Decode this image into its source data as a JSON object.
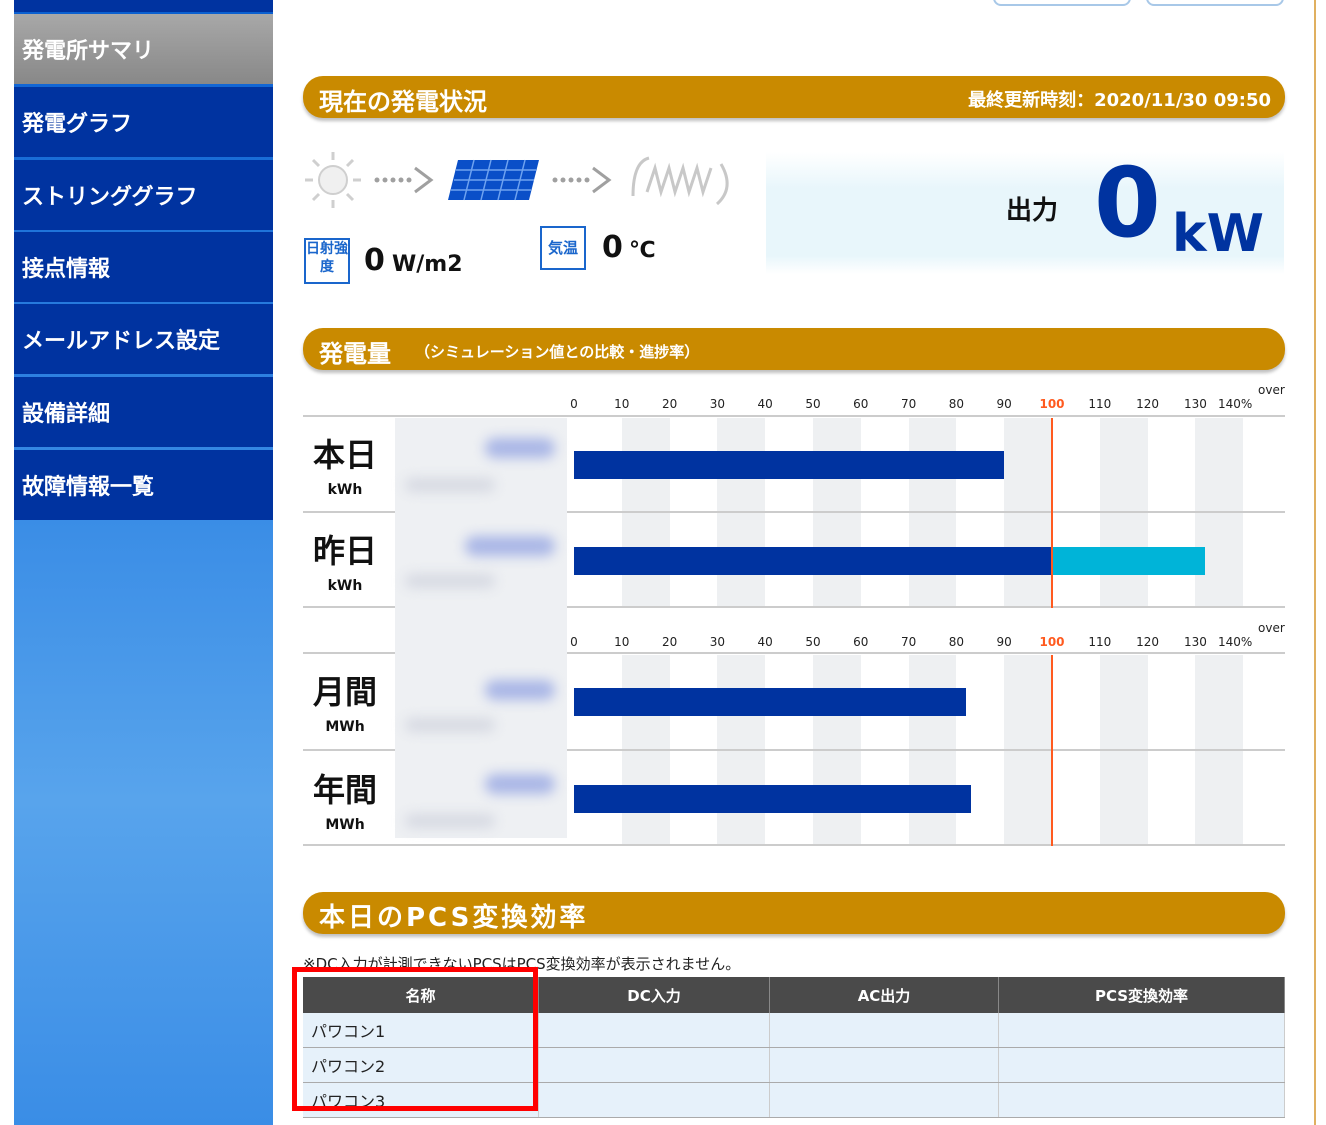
{
  "sidebar": {
    "items": [
      {
        "label": "発電所サマリ",
        "active": true
      },
      {
        "label": "発電グラフ",
        "active": false
      },
      {
        "label": "ストリンググラフ",
        "active": false
      },
      {
        "label": "接点情報",
        "active": false
      },
      {
        "label": "メールアドレス設定",
        "active": false
      },
      {
        "label": "設備詳細",
        "active": false
      },
      {
        "label": "故障情報一覧",
        "active": false
      }
    ]
  },
  "status": {
    "title": "現在の発電状況",
    "updated": "最終更新時刻：2020/11/30 09:50",
    "irradiance_badge": "日射強度",
    "irradiance_value": "0",
    "irradiance_unit": "W/m2",
    "temp_badge": "気温",
    "temp_value": "0",
    "temp_unit": "℃",
    "output_label": "出力",
    "output_value": "0",
    "output_unit": "kW",
    "icons": [
      "sun-icon",
      "arrow-right-icon",
      "solar-panel-icon",
      "arrow-right-icon",
      "power-wave-icon"
    ]
  },
  "generation": {
    "title": "発電量",
    "subtitle": "（シミュレーション値との比較・進捗率）",
    "scale_over": "over",
    "rows_group1": [
      {
        "label": "本日",
        "unit": "kWh"
      },
      {
        "label": "昨日",
        "unit": "kWh"
      }
    ],
    "rows_group2": [
      {
        "label": "月間",
        "unit": "MWh"
      },
      {
        "label": "年間",
        "unit": "MWh"
      }
    ]
  },
  "chart_data": {
    "type": "bar",
    "orientation": "horizontal",
    "x_ticks": [
      "0",
      "10",
      "20",
      "30",
      "40",
      "50",
      "60",
      "70",
      "80",
      "90",
      "100",
      "110",
      "120",
      "130",
      "140%"
    ],
    "xlim": [
      0,
      150
    ],
    "reference_line": 100,
    "colors": {
      "base": "#0033a0",
      "over": "#00b4d8",
      "reference": "#ff5a1f"
    },
    "groups": [
      {
        "categories": [
          "本日",
          "昨日"
        ],
        "values": [
          90,
          132
        ]
      },
      {
        "categories": [
          "月間",
          "年間"
        ],
        "values": [
          82,
          83
        ]
      }
    ]
  },
  "pcs": {
    "title": "本日のPCS変換効率",
    "note": "※DC入力が計測できないPCSはPCS変換効率が表示されません。",
    "headers": [
      "名称",
      "DC入力",
      "AC出力",
      "PCS変換効率"
    ],
    "rows": [
      {
        "name": "パワコン1"
      },
      {
        "name": "パワコン2"
      },
      {
        "name": "パワコン3"
      }
    ]
  }
}
